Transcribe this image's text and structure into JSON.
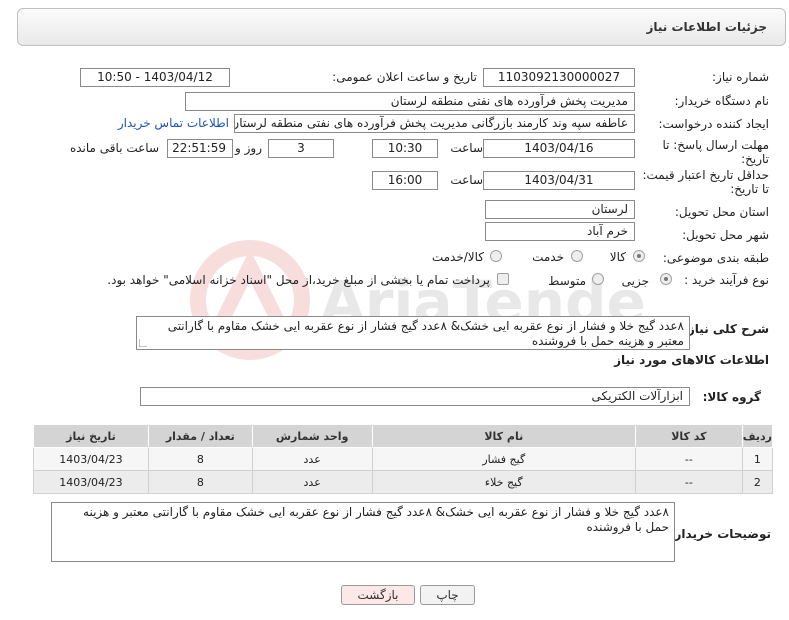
{
  "header": {
    "title": "جزئیات اطلاعات نیاز"
  },
  "fields": {
    "need_number_label": "شماره نیاز:",
    "need_number": "1103092130000027",
    "announce_label": "تاریخ و ساعت اعلان عمومی:",
    "announce_value": "1403/04/12 - 10:50",
    "buyer_org_label": "نام دستگاه خریدار:",
    "buyer_org": "مدیریت پخش فرآورده های نفتی منطقه لرستان",
    "requester_label": "ایجاد کننده درخواست:",
    "requester": "عاطفه سپه وند کارمند بازرگانی مدیریت پخش فرآورده های نفتی منطقه لرستان",
    "contact_link": "اطلاعات تماس خریدار",
    "reply_deadline_label": "مهلت ارسال پاسخ: تا تاریخ:",
    "reply_date": "1403/04/16",
    "time_label": "ساعت",
    "reply_time": "10:30",
    "days_value": "3",
    "days_label": "روز و",
    "remaining_time": "22:51:59",
    "remaining_label": "ساعت باقی مانده",
    "price_validity_label": "حداقل تاریخ اعتبار قیمت: تا تاریخ:",
    "validity_date": "1403/04/31",
    "validity_time": "16:00",
    "province_label": "استان محل تحویل:",
    "province": "لرستان",
    "city_label": "شهر محل تحویل:",
    "city": "خرم آباد",
    "category_label": "طبقه بندی موضوعی:",
    "category_options": [
      "کالا",
      "خدمت",
      "کالا/خدمت"
    ],
    "purchase_type_label": "نوع فرآیند خرید :",
    "purchase_options": [
      "جزیی",
      "متوسط"
    ],
    "payment_note": "پرداخت تمام یا بخشی از مبلغ خرید،از محل \"اسناد خزانه اسلامی\" خواهد بود.",
    "summary_label": "شرح کلی نیاز:",
    "summary": "۸عدد گیج خلا و فشار از نوع عقربه ایی خشک& ۸عدد گیج  فشار از نوع عقربه ایی خشک مقاوم با گارانتی معتبر و هزینه حمل با فروشنده",
    "goods_info_title": "اطلاعات کالاهای مورد نیاز",
    "goods_group_label": "گروه کالا:",
    "goods_group": "ابزارآلات الکتریکی",
    "buyer_notes_label": "توضیحات خریدار:",
    "buyer_notes": "۸عدد گیج خلا و فشار از نوع عقربه ایی خشک& ۸عدد گیج  فشار از نوع عقربه ایی خشک مقاوم با گارانتی معتبر و هزینه حمل با فروشنده"
  },
  "table": {
    "headers": [
      "ردیف",
      "کد کالا",
      "نام کالا",
      "واحد شمارش",
      "تعداد / مقدار",
      "تاریخ نیاز"
    ],
    "rows": [
      [
        "1",
        "--",
        "گیج فشار",
        "عدد",
        "8",
        "1403/04/23"
      ],
      [
        "2",
        "--",
        "گیج خلاء",
        "عدد",
        "8",
        "1403/04/23"
      ]
    ]
  },
  "buttons": {
    "print": "چاپ",
    "back": "بازگشت"
  },
  "watermark_text": "AriaTender.neT"
}
